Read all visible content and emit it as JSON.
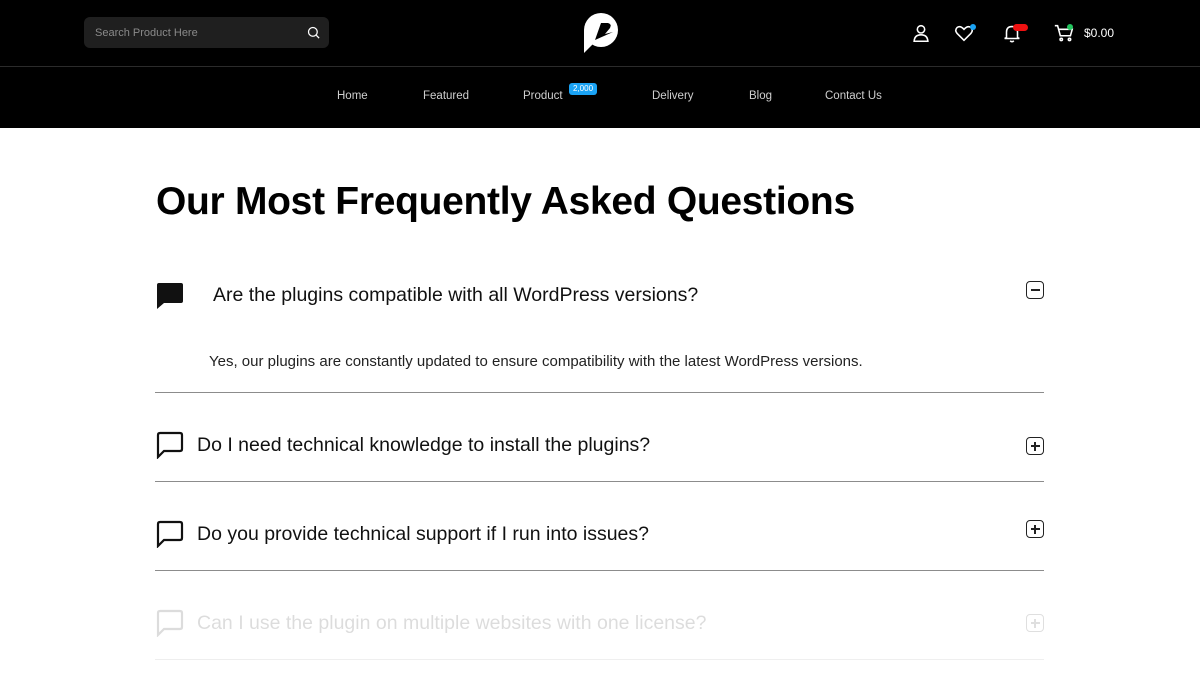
{
  "header": {
    "search": {
      "placeholder": "Search Product Here"
    },
    "cart_total": "$0.00",
    "colors": {
      "wishlist_dot": "#1aa3f5",
      "cart_dot": "#22c55e",
      "notification_badge": "#e11111"
    }
  },
  "nav": {
    "items": [
      {
        "label": "Home"
      },
      {
        "label": "Featured"
      },
      {
        "label": "Product"
      },
      {
        "label": "Delivery"
      },
      {
        "label": "Blog"
      },
      {
        "label": "Contact Us"
      }
    ],
    "product_badge": "2,000"
  },
  "main": {
    "title": "Our Most Frequently Asked Questions",
    "faqs": [
      {
        "question": "Are the plugins compatible with all WordPress versions?",
        "answer": "Yes, our plugins are constantly updated to ensure compatibility with the latest WordPress versions.",
        "expanded": true
      },
      {
        "question": "Do I need technical knowledge to install the plugins?",
        "expanded": false
      },
      {
        "question": "Do you provide technical support if I run into issues?",
        "expanded": false
      },
      {
        "question": "Can I use the plugin on multiple websites with one license?",
        "expanded": false
      }
    ]
  }
}
